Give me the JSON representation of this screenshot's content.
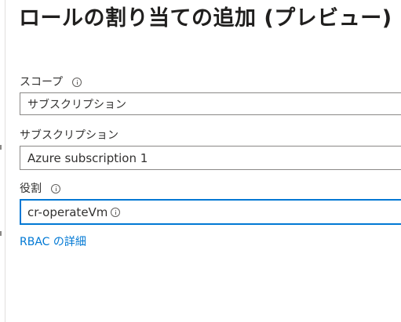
{
  "header": {
    "title": "ロールの割り当ての追加 (プレビュー)"
  },
  "form": {
    "scope": {
      "label": "スコープ",
      "value": "サブスクリプション",
      "has_info_icon": true
    },
    "subscription": {
      "label": "サブスクリプション",
      "value": "Azure subscription 1"
    },
    "role": {
      "label": "役割",
      "value": "cr-operateVm",
      "has_info_icon": true,
      "focused": true
    }
  },
  "links": {
    "rbac_details": "RBAC の詳細"
  },
  "colors": {
    "accent": "#0078d4",
    "border": "#8a8886",
    "text": "#323130"
  },
  "icons": {
    "info": "info-icon"
  }
}
